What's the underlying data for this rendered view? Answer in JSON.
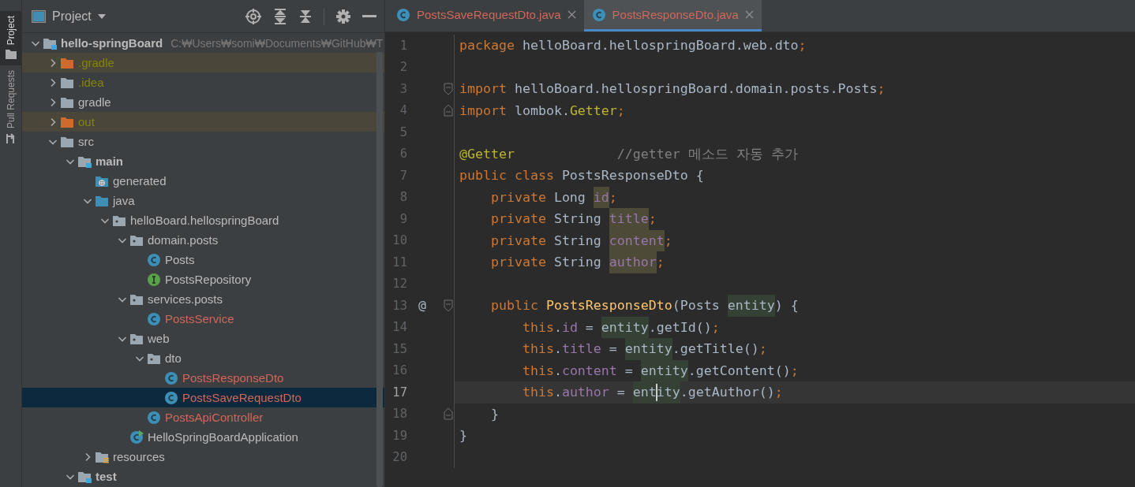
{
  "side_stripe": {
    "tabs": [
      {
        "label": "Project",
        "selected": true,
        "kind": "project"
      },
      {
        "label": "Pull Requests",
        "selected": false,
        "kind": "pull"
      }
    ]
  },
  "project_panel": {
    "title": "Project",
    "tree": [
      {
        "label": "hello-springBoard",
        "path": "C:₩Users₩somi₩Documents₩GitHub₩T",
        "kind": "module",
        "ignored": false,
        "unversioned": false,
        "expanded": true,
        "excluded": false,
        "selected": false,
        "children": [
          {
            "label": ".gradle",
            "kind": "excluded-folder",
            "ignored": true,
            "unversioned": false,
            "expanded": false,
            "excluded": true,
            "selected": false
          },
          {
            "label": ".idea",
            "kind": "folder",
            "ignored": true,
            "unversioned": false,
            "expanded": false,
            "excluded": false,
            "selected": false
          },
          {
            "label": "gradle",
            "kind": "folder",
            "ignored": false,
            "unversioned": false,
            "expanded": false,
            "excluded": false,
            "selected": false
          },
          {
            "label": "out",
            "kind": "excluded-folder",
            "ignored": true,
            "unversioned": false,
            "expanded": false,
            "excluded": true,
            "selected": false
          },
          {
            "label": "src",
            "kind": "folder",
            "ignored": false,
            "unversioned": false,
            "expanded": true,
            "excluded": false,
            "selected": false,
            "children": [
              {
                "label": "main",
                "kind": "module",
                "ignored": false,
                "unversioned": false,
                "expanded": true,
                "excluded": false,
                "selected": false,
                "children": [
                  {
                    "label": "generated",
                    "kind": "generated-folder",
                    "ignored": false,
                    "unversioned": false,
                    "excluded": false,
                    "selected": false
                  },
                  {
                    "label": "java",
                    "kind": "source-folder",
                    "ignored": false,
                    "unversioned": false,
                    "expanded": true,
                    "excluded": false,
                    "selected": false,
                    "children": [
                      {
                        "label": "helloBoard.hellospringBoard",
                        "kind": "package",
                        "ignored": false,
                        "unversioned": false,
                        "expanded": true,
                        "excluded": false,
                        "selected": false,
                        "children": [
                          {
                            "label": "domain.posts",
                            "kind": "package",
                            "ignored": false,
                            "unversioned": false,
                            "expanded": true,
                            "excluded": false,
                            "selected": false,
                            "children": [
                              {
                                "label": "Posts",
                                "kind": "class",
                                "ignored": false,
                                "unversioned": false,
                                "excluded": false,
                                "selected": false
                              },
                              {
                                "label": "PostsRepository",
                                "kind": "interface",
                                "ignored": false,
                                "unversioned": false,
                                "excluded": false,
                                "selected": false
                              }
                            ]
                          },
                          {
                            "label": "services.posts",
                            "kind": "package",
                            "ignored": false,
                            "unversioned": false,
                            "expanded": true,
                            "excluded": false,
                            "selected": false,
                            "children": [
                              {
                                "label": "PostsService",
                                "kind": "class",
                                "ignored": false,
                                "unversioned": true,
                                "excluded": false,
                                "selected": false
                              }
                            ]
                          },
                          {
                            "label": "web",
                            "kind": "package",
                            "ignored": false,
                            "unversioned": false,
                            "expanded": true,
                            "excluded": false,
                            "selected": false,
                            "children": [
                              {
                                "label": "dto",
                                "kind": "package",
                                "ignored": false,
                                "unversioned": false,
                                "expanded": true,
                                "excluded": false,
                                "selected": false,
                                "children": [
                                  {
                                    "label": "PostsResponseDto",
                                    "kind": "class",
                                    "ignored": false,
                                    "unversioned": true,
                                    "excluded": false,
                                    "selected": false
                                  },
                                  {
                                    "label": "PostsSaveRequestDto",
                                    "kind": "class",
                                    "ignored": false,
                                    "unversioned": true,
                                    "excluded": false,
                                    "selected": true
                                  }
                                ]
                              },
                              {
                                "label": "PostsApiController",
                                "kind": "class",
                                "ignored": false,
                                "unversioned": true,
                                "excluded": false,
                                "selected": false
                              }
                            ]
                          },
                          {
                            "label": "HelloSpringBoardApplication",
                            "kind": "app-class",
                            "ignored": false,
                            "unversioned": false,
                            "excluded": false,
                            "selected": false
                          }
                        ]
                      }
                    ]
                  },
                  {
                    "label": "resources",
                    "kind": "resources-folder",
                    "ignored": false,
                    "unversioned": false,
                    "expanded": false,
                    "excluded": false,
                    "selected": false
                  }
                ]
              },
              {
                "label": "test",
                "kind": "module",
                "ignored": false,
                "unversioned": false,
                "expanded": true,
                "excluded": false,
                "selected": false
              }
            ]
          }
        ]
      }
    ]
  },
  "editor": {
    "tabs": [
      {
        "label": "PostsSaveRequestDto.java",
        "selected": false,
        "unversioned": true
      },
      {
        "label": "PostsResponseDto.java",
        "selected": true,
        "unversioned": true
      }
    ],
    "lines": [
      {
        "number": "1",
        "kind": "code",
        "tokens": [
          {
            "t": "package ",
            "kind": "keyword"
          },
          {
            "t": "helloBoard.hellospringBoard.web.dto",
            "kind": "plain"
          },
          {
            "t": ";",
            "kind": "semicolon"
          }
        ]
      },
      {
        "number": "2",
        "kind": "code"
      },
      {
        "number": "3",
        "kind": "fold-start",
        "tokens": [
          {
            "t": "import ",
            "kind": "keyword"
          },
          {
            "t": "helloBoard.hellospringBoard.domain.posts.Posts",
            "kind": "plain"
          },
          {
            "t": ";",
            "kind": "semicolon"
          }
        ]
      },
      {
        "number": "4",
        "kind": "fold-end",
        "tokens": [
          {
            "t": "import ",
            "kind": "keyword"
          },
          {
            "t": "lombok.",
            "kind": "plain"
          },
          {
            "t": "Getter",
            "kind": "annotation"
          },
          {
            "t": ";",
            "kind": "semicolon"
          }
        ]
      },
      {
        "number": "5",
        "kind": "code"
      },
      {
        "number": "6",
        "kind": "code",
        "tokens": [
          {
            "t": "@Getter",
            "kind": "annotation"
          },
          {
            "t": "             //getter 메소드 자동 추가",
            "kind": "comment"
          }
        ]
      },
      {
        "number": "7",
        "kind": "code",
        "tokens": [
          {
            "t": "public class ",
            "kind": "keyword"
          },
          {
            "t": "PostsResponseDto {",
            "kind": "plain"
          }
        ]
      },
      {
        "number": "8",
        "kind": "code",
        "tokens": [
          {
            "t": "    private ",
            "kind": "keyword"
          },
          {
            "t": "Long ",
            "kind": "plain"
          },
          {
            "t": "id",
            "kind": "field-declaration"
          },
          {
            "t": ";",
            "kind": "semicolon"
          }
        ]
      },
      {
        "number": "9",
        "kind": "code",
        "tokens": [
          {
            "t": "    private ",
            "kind": "keyword"
          },
          {
            "t": "String ",
            "kind": "plain"
          },
          {
            "t": "title",
            "kind": "field-declaration"
          },
          {
            "t": ";",
            "kind": "semicolon"
          }
        ]
      },
      {
        "number": "10",
        "kind": "code",
        "tokens": [
          {
            "t": "    private ",
            "kind": "keyword"
          },
          {
            "t": "String ",
            "kind": "plain"
          },
          {
            "t": "content",
            "kind": "field-declaration"
          },
          {
            "t": ";",
            "kind": "semicolon"
          }
        ]
      },
      {
        "number": "11",
        "kind": "code",
        "tokens": [
          {
            "t": "    private ",
            "kind": "keyword"
          },
          {
            "t": "String ",
            "kind": "plain"
          },
          {
            "t": "author",
            "kind": "field-declaration"
          },
          {
            "t": ";",
            "kind": "semicolon"
          }
        ]
      },
      {
        "number": "12",
        "kind": "code"
      },
      {
        "number": "13",
        "kind": "fold-start",
        "gutter_mark": "@",
        "tokens": [
          {
            "t": "    public ",
            "kind": "keyword"
          },
          {
            "t": "PostsResponseDto",
            "kind": "constructor"
          },
          {
            "t": "(Posts ",
            "kind": "plain"
          },
          {
            "t": "entity",
            "kind": "reference"
          },
          {
            "t": ") {",
            "kind": "plain"
          }
        ]
      },
      {
        "number": "14",
        "kind": "code",
        "tokens": [
          {
            "t": "        this",
            "kind": "keyword"
          },
          {
            "t": ".",
            "kind": "plain"
          },
          {
            "t": "id",
            "kind": "field"
          },
          {
            "t": " = ",
            "kind": "plain"
          },
          {
            "t": "entity",
            "kind": "reference"
          },
          {
            "t": ".getId()",
            "kind": "plain"
          },
          {
            "t": ";",
            "kind": "semicolon"
          }
        ]
      },
      {
        "number": "15",
        "kind": "code",
        "tokens": [
          {
            "t": "        this",
            "kind": "keyword"
          },
          {
            "t": ".",
            "kind": "plain"
          },
          {
            "t": "title",
            "kind": "field"
          },
          {
            "t": " = ",
            "kind": "plain"
          },
          {
            "t": "entity",
            "kind": "reference"
          },
          {
            "t": ".getTitle()",
            "kind": "plain"
          },
          {
            "t": ";",
            "kind": "semicolon"
          }
        ]
      },
      {
        "number": "16",
        "kind": "code",
        "tokens": [
          {
            "t": "        this",
            "kind": "keyword"
          },
          {
            "t": ".",
            "kind": "plain"
          },
          {
            "t": "content",
            "kind": "field"
          },
          {
            "t": " = ",
            "kind": "plain"
          },
          {
            "t": "entity",
            "kind": "reference"
          },
          {
            "t": ".getContent()",
            "kind": "plain"
          },
          {
            "t": ";",
            "kind": "semicolon"
          }
        ]
      },
      {
        "number": "17",
        "kind": "code",
        "current": true,
        "tokens": [
          {
            "t": "        this",
            "kind": "keyword"
          },
          {
            "t": ".",
            "kind": "plain"
          },
          {
            "t": "author",
            "kind": "field"
          },
          {
            "t": " = ",
            "kind": "plain"
          },
          {
            "t": "ent",
            "kind": "reference"
          },
          {
            "t": "ity",
            "kind": "reference",
            "caret_before": true
          },
          {
            "t": ".getAuthor()",
            "kind": "plain"
          },
          {
            "t": ";",
            "kind": "semicolon"
          }
        ]
      },
      {
        "number": "18",
        "kind": "fold-end",
        "tokens": [
          {
            "t": "    }",
            "kind": "plain"
          }
        ]
      },
      {
        "number": "19",
        "kind": "code",
        "tokens": [
          {
            "t": "}",
            "kind": "plain"
          }
        ]
      },
      {
        "number": "20",
        "kind": "code"
      }
    ]
  }
}
